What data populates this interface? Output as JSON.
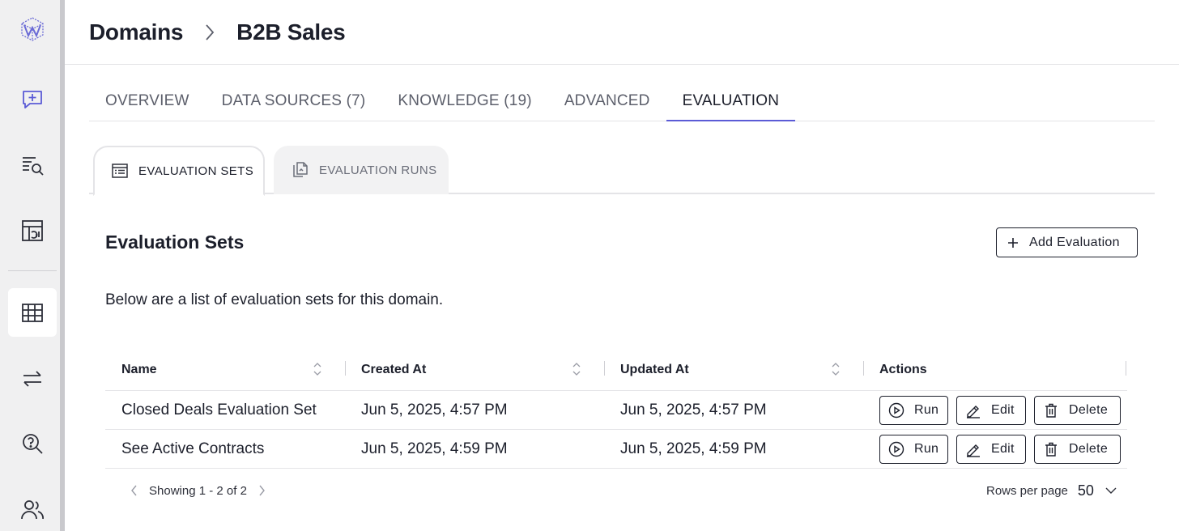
{
  "sidebar": {
    "items": [
      {
        "icon": "logo-icon"
      },
      {
        "icon": "chat-plus-icon"
      },
      {
        "icon": "search-list-icon"
      },
      {
        "icon": "dashboard-icon"
      },
      {
        "icon": "table-icon"
      },
      {
        "icon": "transfer-icon"
      },
      {
        "icon": "help-search-icon"
      },
      {
        "icon": "users-icon"
      }
    ]
  },
  "breadcrumb": {
    "root": "Domains",
    "current": "B2B Sales"
  },
  "tabs": [
    "OVERVIEW",
    "DATA SOURCES (7)",
    "KNOWLEDGE (19)",
    "ADVANCED",
    "EVALUATION"
  ],
  "subtabs": {
    "sets": "EVALUATION SETS",
    "runs": "EVALUATION RUNS"
  },
  "section": {
    "title": "Evaluation Sets",
    "add_label": "Add Evaluation",
    "description": "Below are a list of evaluation sets for this domain."
  },
  "table": {
    "headers": {
      "name": "Name",
      "created": "Created At",
      "updated": "Updated At",
      "actions": "Actions"
    },
    "rows": [
      {
        "name": "Closed Deals Evaluation Set",
        "created": "Jun 5, 2025, 4:57 PM",
        "updated": "Jun 5, 2025, 4:57 PM"
      },
      {
        "name": "See Active Contracts",
        "created": "Jun 5, 2025, 4:59 PM",
        "updated": "Jun 5, 2025, 4:59 PM"
      }
    ],
    "actions": {
      "run": "Run",
      "edit": "Edit",
      "delete": "Delete"
    }
  },
  "pagination": {
    "showing": "Showing 1 - 2 of 2",
    "rows_label": "Rows per page",
    "rows_value": "50"
  },
  "colors": {
    "accent": "#5b5bd6",
    "sidebar_bg": "#f0f0f1"
  }
}
